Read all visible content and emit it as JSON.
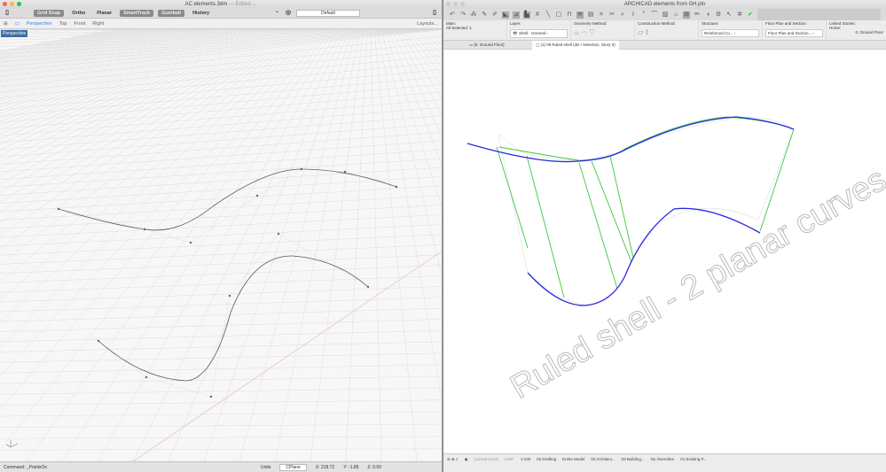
{
  "rhino": {
    "title": "AC elements.3dm",
    "edited": "— Edited ⌄",
    "toolbar": [
      "Grid Snap",
      "Ortho",
      "Planar",
      "SmartTrack",
      "Gumball",
      "History"
    ],
    "toolbar_on": [
      true,
      false,
      false,
      true,
      true,
      false
    ],
    "layer": "Default",
    "tabs": [
      "Perspective",
      "Top",
      "Front",
      "Right"
    ],
    "layouts": "Layouts...",
    "viewport_label": "Perspective",
    "status": {
      "command": "Command: _PointsOn",
      "units": "Units",
      "cplane": "CPlane",
      "x": "X: 218.72",
      "y": "Y: -1.89",
      "z": "Z: 0.00"
    }
  },
  "archicad": {
    "title": "ARCHICAD elements from GH.pln",
    "info": {
      "main": "Main:",
      "all_selected": "All Selected: 1",
      "layer_label": "Layer:",
      "layer": "Shell - General",
      "geometry": "Geometry Method:",
      "construction": "Construction Method:",
      "structure_label": "Structure:",
      "structure": "Reinforced Co...",
      "fps_label": "Floor Plan and Section:",
      "fps": "Floor Plan and Section...",
      "linked_label": "Linked Stories:",
      "home": "Home:",
      "story": "0. Ground Floor"
    },
    "tabs": [
      "[0. Ground Floor]",
      "(1) 09 Ruled shell (3D / Selection, Story 0)"
    ],
    "watermark": "Ruled shell - 2 planar curves",
    "nav": [
      "Current Zoom",
      "0.00°",
      "1:100",
      "02 Drafting",
      "Entire Model",
      "03 Architect...",
      "03 Building...",
      "No Overrides",
      "01 Existing P..."
    ]
  },
  "colors": {
    "blue": "#2a2ae0",
    "green": "#3cc83c",
    "accent": "#3b7ddd"
  }
}
